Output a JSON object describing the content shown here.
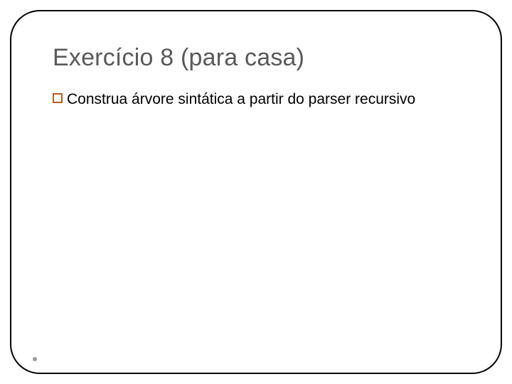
{
  "slide": {
    "title": "Exercício 8 (para casa)",
    "bullets": [
      {
        "text": "Construa árvore sintática a partir do parser recursivo"
      }
    ]
  }
}
